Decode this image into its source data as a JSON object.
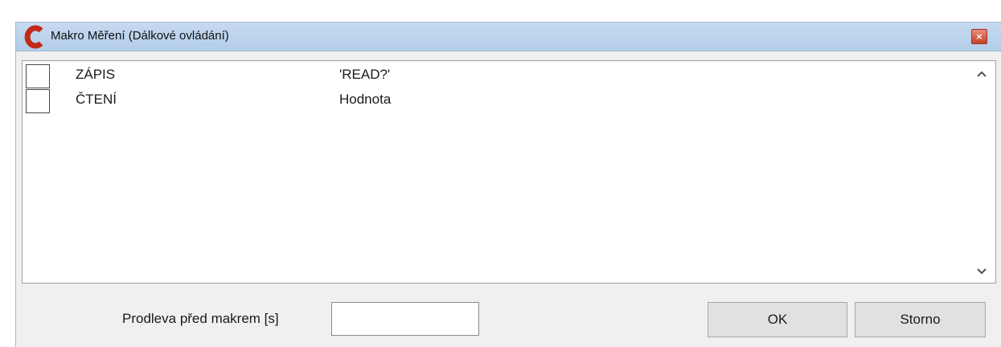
{
  "window": {
    "title": "Makro Měření (Dálkové ovládání)",
    "app_icon": "c-logo-icon",
    "close_symbol": "×",
    "accent_color": "#c7402a"
  },
  "macro_list": {
    "rows": [
      {
        "checked": false,
        "command": "ZÁPIS",
        "value": "'READ?'"
      },
      {
        "checked": false,
        "command": "ČTENÍ",
        "value": "Hodnota"
      }
    ],
    "scroll_up_icon": "chevron-up-icon",
    "scroll_down_icon": "chevron-down-icon"
  },
  "footer": {
    "delay_label": "Prodleva před makrem [s]",
    "delay_value": "",
    "ok_label": "OK",
    "cancel_label": "Storno"
  }
}
